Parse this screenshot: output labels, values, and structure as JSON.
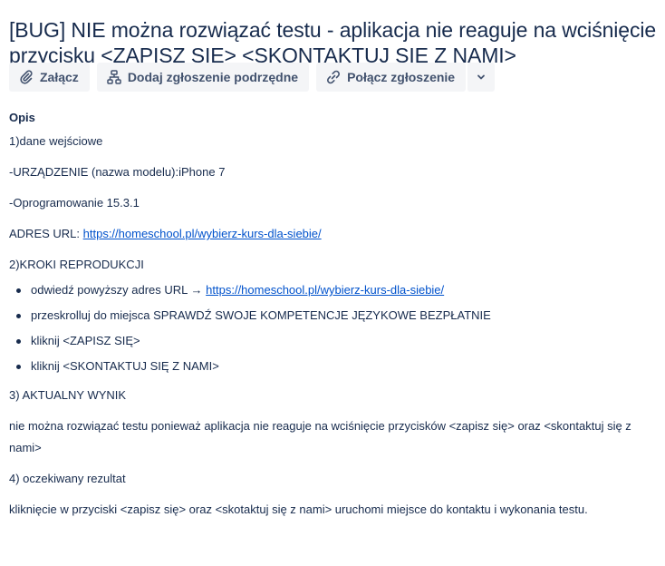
{
  "issue": {
    "title": "[BUG] NIE można rozwiązać testu - aplikacja nie reaguje na wciśnięcie przycisku <ZAPISZ SIĘ> <SKONTAKTUJ SIĘ Z NAMI>"
  },
  "toolbar": {
    "attach_label": "Załącz",
    "attach_icon": "paperclip-icon",
    "child_issue_label": "Dodaj zgłoszenie podrzędne",
    "child_issue_icon": "hierarchy-icon",
    "link_issue_label": "Połącz zgłoszenie",
    "link_issue_icon": "link-icon",
    "more_icon": "chevron-down-icon"
  },
  "description": {
    "heading": "Opis",
    "input_data_heading": "1)dane wejściowe",
    "device": "-URZĄDZENIE (nazwa modelu):iPhone 7",
    "software": "-Oprogramowanie 15.3.1",
    "url_label": "ADRES URL: ",
    "url": "https://homeschool.pl/wybierz-kurs-dla-siebie/",
    "steps_heading": "2)KROKI REPRODUKCJI",
    "steps": {
      "s1_text": "odwiedź powyższy adres URL → ",
      "s1_link": "https://homeschool.pl/wybierz-kurs-dla-siebie/",
      "s2": "przeskrolluj do miejsca SPRAWDŹ SWOJE KOMPETENCJE JĘZYKOWE BEZPŁATNIE",
      "s3": "kliknij <ZAPISZ SIĘ>",
      "s4": "kliknij <SKONTAKTUJ SIĘ Z NAMI>"
    },
    "actual_heading": "3) AKTUALNY WYNIK",
    "actual_text": "nie można rozwiązać testu ponieważ aplikacja nie reaguje na wciśnięcie przycisków <zapisz się> oraz <skontaktuj się z nami>",
    "expected_heading": "4) oczekiwany rezultat",
    "expected_text": "kliknięcie w przyciski <zapisz się> oraz <skotaktuj się z nami> uruchomi miejsce do kontaktu i wykonania testu."
  },
  "colors": {
    "text": "#172b4d",
    "link": "#0052cc",
    "button_bg": "#f4f5f7",
    "button_text": "#42526e"
  }
}
